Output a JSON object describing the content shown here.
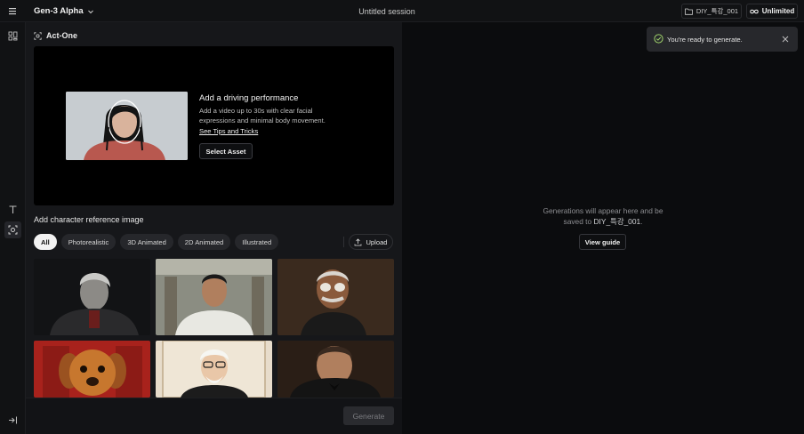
{
  "topbar": {
    "model": "Gen-3 Alpha",
    "session_title": "Untitled session",
    "folder": "DIY_특강_001",
    "plan": "Unlimited"
  },
  "panel": {
    "tool_name": "Act-One",
    "driving": {
      "title": "Add a driving performance",
      "description": "Add a video up to 30s with clear facial expressions and minimal body movement.",
      "link": "See Tips and Tricks",
      "button": "Select Asset"
    },
    "reference": {
      "label": "Add character reference image",
      "filters": [
        "All",
        "Photorealistic",
        "3D Animated",
        "2D Animated",
        "Illustrated"
      ],
      "active_filter": "All",
      "upload": "Upload"
    },
    "generate": "Generate"
  },
  "output": {
    "empty_line1": "Generations will appear here and be",
    "empty_prefix": "saved to ",
    "empty_folder": "DIY_특강_001",
    "empty_suffix": ".",
    "guide_button": "View guide"
  },
  "toast": {
    "message": "You're ready to generate."
  },
  "colors": {
    "accent_success": "#9fd26b",
    "button_disabled_bg": "#2a2b2f",
    "chip_active_bg": "#f2f2f2"
  }
}
